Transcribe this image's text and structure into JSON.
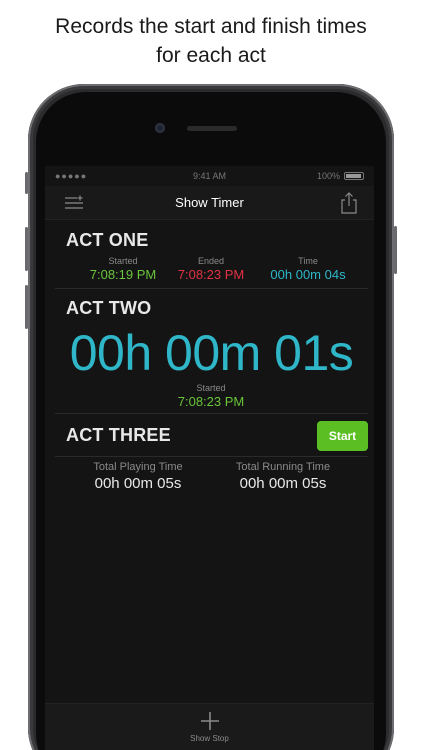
{
  "caption": {
    "line1": "Records the start and finish times",
    "line2": "for each act"
  },
  "status_bar": {
    "signal": "●●●●● ",
    "time": "9:41 AM",
    "battery_text": "100%"
  },
  "nav": {
    "title": "Show Timer",
    "menu_icon": "list-settings-icon",
    "share_icon": "share-icon"
  },
  "acts": [
    {
      "name": "ACT ONE",
      "started_label": "Started",
      "started": "7:08:19 PM",
      "ended_label": "Ended",
      "ended": "7:08:23 PM",
      "time_label": "Time",
      "time": "00h 00m 04s"
    },
    {
      "name": "ACT TWO",
      "timer": "00h 00m 01s",
      "started_label": "Started",
      "started": "7:08:23 PM"
    },
    {
      "name": "ACT THREE",
      "button": "Start"
    }
  ],
  "totals": {
    "playing_label": "Total Playing Time",
    "playing": "00h 00m 05s",
    "running_label": "Total Running Time",
    "running": "00h 00m 05s"
  },
  "toolbar": {
    "label": "Show Stop",
    "icon": "plus-icon"
  },
  "colors": {
    "green": "#69c53a",
    "red": "#e03243",
    "cyan": "#2fb7c9",
    "button_green": "#5bbf23"
  }
}
